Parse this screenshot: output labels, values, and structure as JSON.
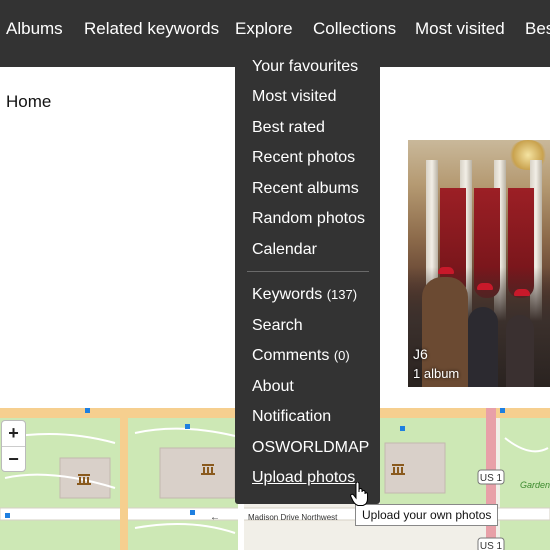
{
  "nav": {
    "items": [
      "Albums",
      "Related keywords",
      "Explore",
      "Collections",
      "Most visited",
      "Bes"
    ]
  },
  "breadcrumb": "Home",
  "explore_menu": {
    "group1": [
      "Your favourites",
      "Most visited",
      "Best rated",
      "Recent photos",
      "Recent albums",
      "Random photos",
      "Calendar"
    ],
    "keywords": {
      "label": "Keywords",
      "count": "(137)"
    },
    "search": "Search",
    "comments": {
      "label": "Comments",
      "count": "(0)"
    },
    "about": "About",
    "notification": "Notification",
    "osworldmap": "OSWORLDMAP",
    "upload": "Upload photos"
  },
  "tooltip": "Upload your own photos",
  "album": {
    "title": "J6",
    "count": "1 album"
  },
  "map": {
    "zoom_in": "+",
    "zoom_out": "−",
    "street_label": "Madison Drive Northwest",
    "arrow": "←",
    "shields": [
      "US 1",
      "US 1"
    ],
    "garden_label": "Garden"
  },
  "colors": {
    "nav_bg": "#333333",
    "menu_bg": "#333333",
    "map_bg": "#f1efe8",
    "park_green": "#cde8b5",
    "road_orange": "#f6cf8f",
    "road_red": "#e8a0a8"
  }
}
